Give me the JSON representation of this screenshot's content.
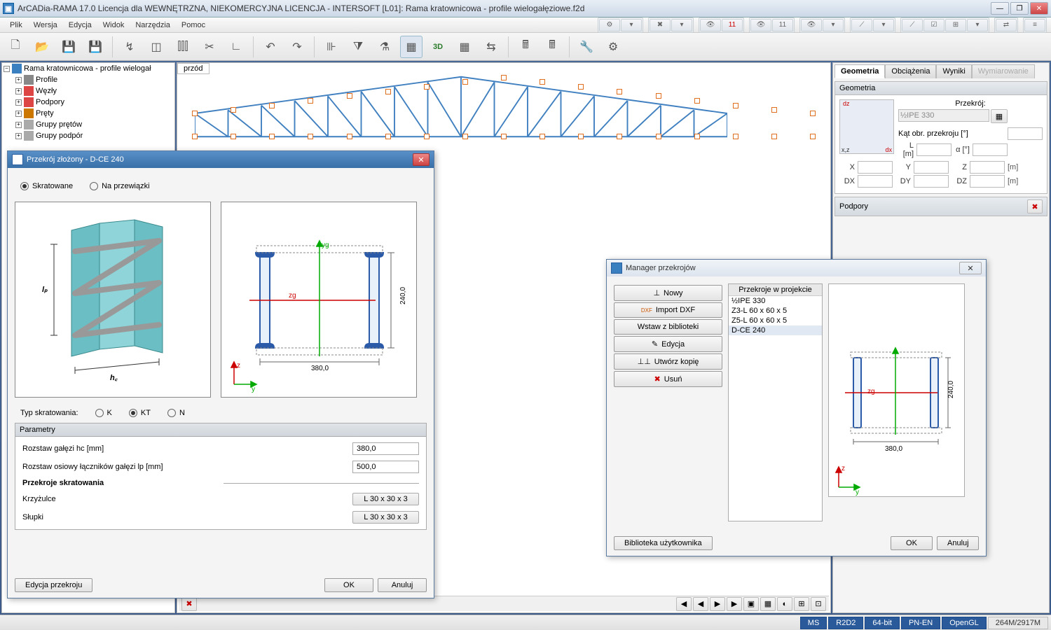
{
  "titlebar": {
    "text": "ArCADia-RAMA 17.0 Licencja dla WEWNĘTRZNA, NIEKOMERCYJNA LICENCJA - INTERSOFT [L01]: Rama kratownicowa - profile wielogałęziowe.f2d",
    "min": "—",
    "max": "❐",
    "close": "✕"
  },
  "menu": [
    "Plik",
    "Wersja",
    "Edycja",
    "Widok",
    "Narzędzia",
    "Pomoc"
  ],
  "ribbon_badges": {
    "a": "11",
    "b": "11"
  },
  "tree": {
    "root": "Rama kratownicowa - profile wielogał",
    "items": [
      "Profile",
      "Węzły",
      "Podpory",
      "Pręty",
      "Grupy prętów",
      "Grupy podpór"
    ]
  },
  "canvas": {
    "tab": "przód",
    "del_icon": "✖"
  },
  "nav_btns": [
    "◀",
    "◀",
    "▶",
    "▶"
  ],
  "right": {
    "tabs": [
      "Geometria",
      "Obciążenia",
      "Wyniki",
      "Wymiarowanie"
    ],
    "sec_geom": "Geometria",
    "sec_prz": "Przekrój:",
    "prz_val": "½IPE 330",
    "kat_lbl": "Kąt obr. przekroju [°]",
    "rows": {
      "L": "L [m]",
      "a": "α [°]",
      "X": "X",
      "Y": "Y",
      "Z": "Z",
      "m1": "[m]",
      "DX": "DX",
      "DY": "DY",
      "DZ": "DZ",
      "m2": "[m]"
    },
    "axes": {
      "dz": "dz",
      "dx": "dx",
      "xz": "x,z"
    },
    "sec_pod": "Podpory"
  },
  "status": {
    "cells": [
      "MS",
      "R2D2",
      "64-bit",
      "PN-EN",
      "OpenGL"
    ],
    "mem": "264M/2917M"
  },
  "dlg1": {
    "title": "Przekrój złożony - D-CE 240",
    "r1": "Skratowane",
    "r2": "Na przewiązki",
    "preview_labels": {
      "lp": "lₚ",
      "hc": "h꜀",
      "width": "380,0",
      "height": "240,0",
      "yg": "yg",
      "zg": "zg",
      "z": "z",
      "y": "y"
    },
    "typ_lbl": "Typ skratowania:",
    "typ_opts": [
      "K",
      "KT",
      "N"
    ],
    "param_hdr": "Parametry",
    "rows": {
      "hc_lbl": "Rozstaw gałęzi hc [mm]",
      "hc_val": "380,0",
      "lp_lbl": "Rozstaw osiowy łączników gałęzi lp [mm]",
      "lp_val": "500,0",
      "sk_hdr": "Przekroje skratowania",
      "krz_lbl": "Krzyżulce",
      "krz_val": "L 30 x 30 x 3",
      "slu_lbl": "Słupki",
      "slu_val": "L 30 x 30 x 3"
    },
    "edit_btn": "Edycja przekroju",
    "ok": "OK",
    "cancel": "Anuluj"
  },
  "dlg2": {
    "title": "Manager przekrojów",
    "btns": {
      "nowy": "Nowy",
      "dxf": "Import DXF",
      "wstaw": "Wstaw z biblioteki",
      "edy": "Edycja",
      "kop": "Utwórz kopię",
      "usun": "Usuń",
      "bib": "Biblioteka użytkownika"
    },
    "list_hdr": "Przekroje w projekcie",
    "list": [
      "½IPE 330",
      "Z3-L 60 x 60 x 5",
      "Z5-L 60 x 60 x 5",
      "D-CE 240"
    ],
    "preview_labels": {
      "width": "380,0",
      "height": "240,0",
      "zg": "zg",
      "z": "z",
      "y": "y"
    },
    "ok": "OK",
    "cancel": "Anuluj",
    "close": "✕"
  }
}
